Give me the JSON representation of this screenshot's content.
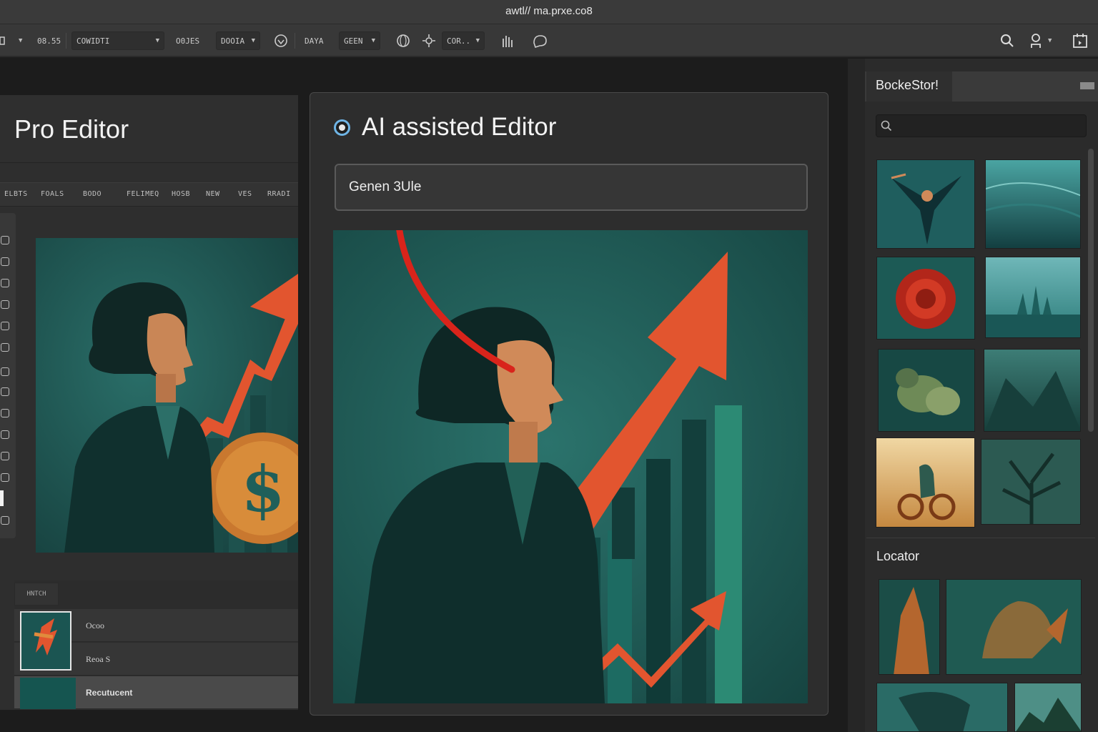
{
  "titlebar": {
    "url": "awtl// ma.prxe.co8"
  },
  "toolbar": {
    "items": [
      {
        "label": "08.55"
      },
      {
        "label": "COWIDTI"
      },
      {
        "label": "O0JES"
      },
      {
        "label": "DOOIA"
      },
      {
        "label": "DAYA"
      },
      {
        "label": "GEEN"
      },
      {
        "label": "COR.."
      }
    ]
  },
  "pro_editor": {
    "title": "Pro Editor",
    "tabs": [
      "ELBTS",
      "FOALS",
      "BODO",
      "FELIMEQ",
      "HOSB",
      "NEW",
      "VES",
      "RRADI"
    ],
    "layers_tab": "HNTCH",
    "layers": [
      {
        "label": "Ocoo"
      },
      {
        "label": "Reoa S"
      },
      {
        "label": "Recutucent"
      }
    ]
  },
  "ai_editor": {
    "title": "AI assisted Editor",
    "input_value": "Genen 3Ule"
  },
  "right_panel": {
    "title": "BockeStor!",
    "search_placeholder": "",
    "section2_title": "Locator"
  },
  "colors": {
    "teal": "#1f5f5a",
    "accent_orange": "#e2552f",
    "stroke_red": "#d9241b",
    "radio_blue": "#6fb5e6"
  }
}
